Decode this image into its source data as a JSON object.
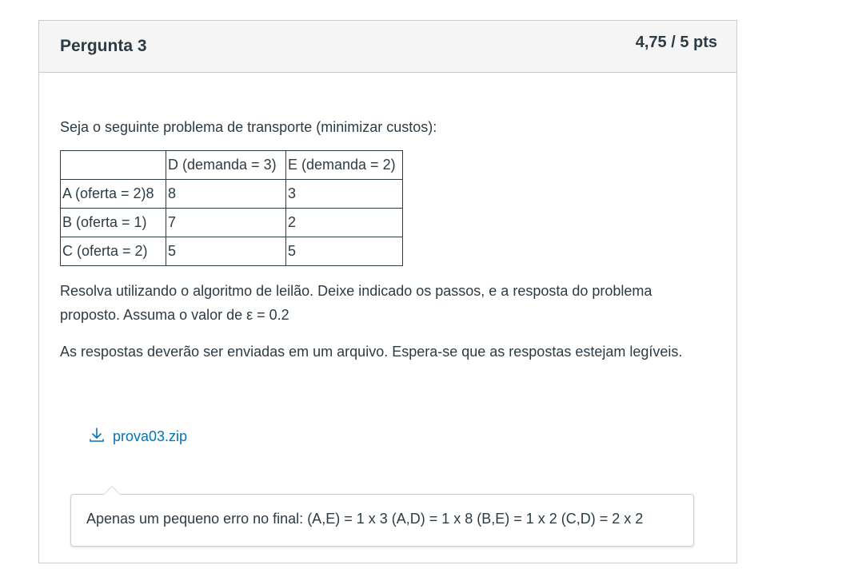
{
  "question": {
    "title": "Pergunta 3",
    "score": "4,75 / 5 pts",
    "intro": "Seja o seguinte problema de transporte (minimizar custos):",
    "table": {
      "header": [
        "",
        "D (demanda = 3)",
        "E (demanda = 2)"
      ],
      "rows": [
        [
          "A (oferta = 2)8",
          "8",
          "3"
        ],
        [
          "B (oferta = 1)",
          "7",
          "2"
        ],
        [
          "C (oferta = 2)",
          "5",
          "5"
        ]
      ]
    },
    "instruction": "Resolva utilizando o algoritmo de leilão. Deixe indicado os passos, e a resposta do problema proposto. Assuma o valor de ε = 0.2",
    "submission_note": "As respostas deverão ser enviadas em um arquivo. Espera-se que as respostas estejam legíveis."
  },
  "attachment": {
    "icon": "download-icon",
    "filename": "prova03.zip",
    "color": "#0374b5"
  },
  "comment": {
    "text": "Apenas um pequeno erro no final: (A,E) = 1 x 3 (A,D) = 1 x 8 (B,E) = 1 x 2 (C,D) = 2 x 2"
  }
}
